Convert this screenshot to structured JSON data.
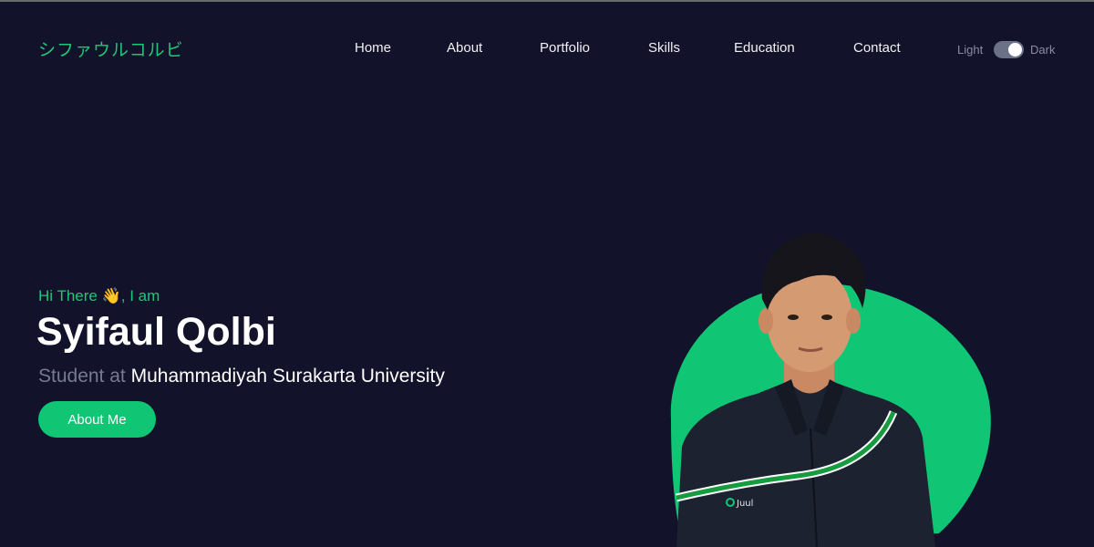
{
  "logo": "シファウルコルビ",
  "nav": {
    "items": [
      {
        "label": "Home"
      },
      {
        "label": "About"
      },
      {
        "label": "Portfolio"
      },
      {
        "label": "Skills"
      },
      {
        "label": "Education"
      },
      {
        "label": "Contact"
      }
    ]
  },
  "theme_toggle": {
    "light_label": "Light",
    "dark_label": "Dark",
    "state": "dark"
  },
  "hero": {
    "greeting": "Hi There 👋, I am",
    "name": "Syifaul Qolbi",
    "role_prefix": "Student at",
    "role_org": "Muhammadiyah Surakarta University",
    "cta_label": "About Me",
    "shirt_badge": "Juul"
  },
  "colors": {
    "background": "#12122a",
    "accent": "#10c675",
    "text": "#ffffff",
    "muted": "#767a93"
  },
  "icons": {
    "greeting_emoji": "waving-hand-icon"
  }
}
